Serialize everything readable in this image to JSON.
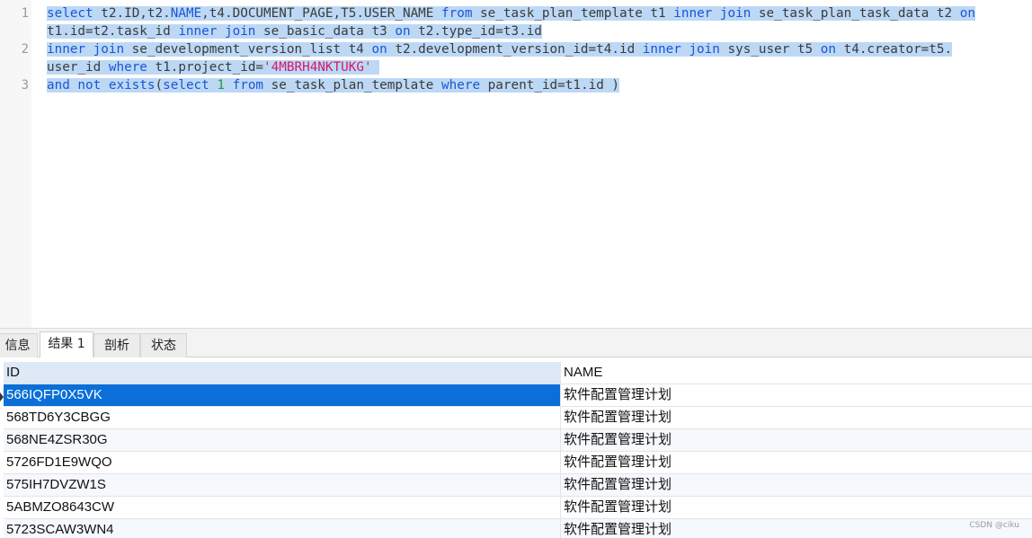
{
  "editor": {
    "line_numbers": [
      "1",
      "2",
      "3"
    ],
    "lines": [
      [
        {
          "t": "select",
          "c": "kw"
        },
        {
          "t": " t2.ID,t2.",
          "c": ""
        },
        {
          "t": "NAME",
          "c": "kw"
        },
        {
          "t": ",t4.DOCUMENT_PAGE,T5.USER_NAME ",
          "c": ""
        },
        {
          "t": "from",
          "c": "kw"
        },
        {
          "t": " se_task_plan_template t1 ",
          "c": ""
        },
        {
          "t": "inner join",
          "c": "kw"
        },
        {
          "t": " se_task_plan_task_data t2 ",
          "c": ""
        },
        {
          "t": "on",
          "c": "kw"
        }
      ],
      [
        {
          "t": "t1.id=t2.task_id ",
          "c": ""
        },
        {
          "t": "inner join",
          "c": "kw"
        },
        {
          "t": " se_basic_data t3 ",
          "c": ""
        },
        {
          "t": "on",
          "c": "kw"
        },
        {
          "t": " t2.type_id=t3.id",
          "c": ""
        }
      ],
      [
        {
          "t": "inner join",
          "c": "kw"
        },
        {
          "t": " se_development_version_list t4 ",
          "c": ""
        },
        {
          "t": "on",
          "c": "kw"
        },
        {
          "t": " t2.development_version_id=t4.id ",
          "c": ""
        },
        {
          "t": "inner join",
          "c": "kw"
        },
        {
          "t": " sys_user t5 ",
          "c": ""
        },
        {
          "t": "on",
          "c": "kw"
        },
        {
          "t": " t4.creator=t5.",
          "c": ""
        }
      ],
      [
        {
          "t": "user_id ",
          "c": ""
        },
        {
          "t": "where",
          "c": "kw"
        },
        {
          "t": " t1.project_id=",
          "c": ""
        },
        {
          "t": "'4MBRH4NKTUKG'",
          "c": "str"
        },
        {
          "t": " ",
          "c": ""
        }
      ],
      [
        {
          "t": "and not exists",
          "c": "kw"
        },
        {
          "t": "(",
          "c": ""
        },
        {
          "t": "select",
          "c": "kw"
        },
        {
          "t": " ",
          "c": ""
        },
        {
          "t": "1",
          "c": "num"
        },
        {
          "t": " ",
          "c": ""
        },
        {
          "t": "from",
          "c": "kw"
        },
        {
          "t": " se_task_plan_template ",
          "c": ""
        },
        {
          "t": "where",
          "c": "kw"
        },
        {
          "t": " parent_id=t1.id )",
          "c": ""
        }
      ]
    ]
  },
  "tabs": [
    {
      "label": "信息"
    },
    {
      "label": "结果 1"
    },
    {
      "label": "剖析"
    },
    {
      "label": "状态"
    }
  ],
  "result": {
    "columns": [
      "ID",
      "NAME"
    ],
    "rows": [
      [
        "566IQFP0X5VK",
        "软件配置管理计划"
      ],
      [
        "568TD6Y3CBGG",
        "软件配置管理计划"
      ],
      [
        "568NE4ZSR30G",
        "软件配置管理计划"
      ],
      [
        "5726FD1E9WQO",
        "软件配置管理计划"
      ],
      [
        "575IH7DVZW1S",
        "软件配置管理计划"
      ],
      [
        "5ABMZO8643CW",
        "软件配置管理计划"
      ],
      [
        "5723SCAW3WN4",
        "软件配置管理计划"
      ]
    ]
  },
  "watermark": "CSDN @ciku",
  "colors": {
    "keyword": "#1b55d4",
    "string": "#d6186b",
    "number": "#1e9a47",
    "selection": "#bcd8f5",
    "selected_row": "#0a6fd8"
  }
}
